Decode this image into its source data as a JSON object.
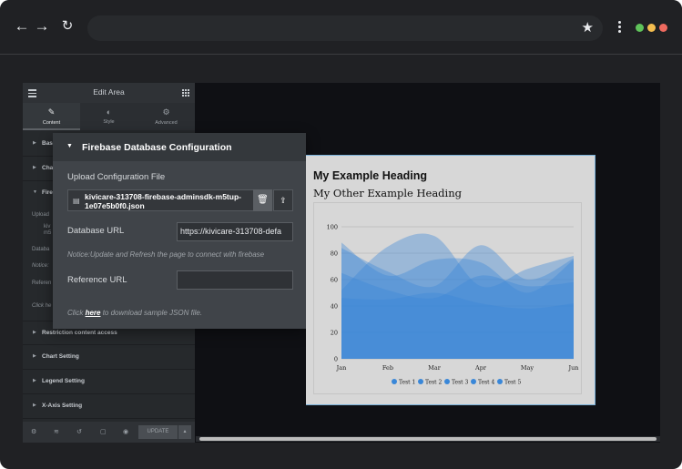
{
  "browser": {
    "back": "←",
    "forward": "→",
    "reload": "↻",
    "star": "★",
    "address": "",
    "traffic_colors": [
      "#5fc35a",
      "#f4bd4f",
      "#ee6a5f"
    ]
  },
  "panel": {
    "title": "Edit Area",
    "tabs": [
      {
        "label": "Content",
        "icon": "pencil-icon"
      },
      {
        "label": "Style",
        "icon": "contrast-icon"
      },
      {
        "label": "Advanced",
        "icon": "gear-icon"
      }
    ],
    "sections_top": [
      "Bas",
      "Cha",
      "Fire"
    ],
    "ghost_lines": [
      "Upload",
      "kiv",
      "m5",
      "Databa",
      "Notice:",
      "Referen",
      "Click he"
    ],
    "sections_bottom": [
      "Restriction content access",
      "Chart Setting",
      "Legend Setting",
      "X-Axis Setting"
    ],
    "footer": {
      "update": "UPDATE",
      "more": "▴"
    }
  },
  "popover": {
    "title": "Firebase Database Configuration",
    "upload_label": "Upload Configuration File",
    "file_name": "kivicare-313708-firebase-adminsdk-m5tup-1e07e5b0f0.json",
    "db_url_label": "Database URL",
    "db_url_value": "https://kivicare-313708-defa",
    "notice": "Notice:Update and Refresh the page to connect with firebase",
    "ref_url_label": "Reference URL",
    "ref_url_value": "",
    "hint_prefix": "Click ",
    "hint_link": "here",
    "hint_suffix": " to download sample JSON file."
  },
  "preview": {
    "heading": "My Example Heading",
    "subheading": "My Other Example Heading"
  },
  "chart_data": {
    "type": "area",
    "categories": [
      "Jan",
      "Feb",
      "Mar",
      "Apr",
      "May",
      "Jun"
    ],
    "y_ticks": [
      0,
      20,
      40,
      60,
      80,
      100
    ],
    "ylim": [
      0,
      100
    ],
    "grid": true,
    "legend_placement": "bottom",
    "fill_color": "#3a86d6",
    "series": [
      {
        "name": "Test 1",
        "values": [
          88,
          63,
          75,
          73,
          50,
          75
        ]
      },
      {
        "name": "Test 2",
        "values": [
          52,
          85,
          93,
          55,
          68,
          78
        ]
      },
      {
        "name": "Test 3",
        "values": [
          84,
          66,
          55,
          86,
          60,
          76
        ]
      },
      {
        "name": "Test 4",
        "values": [
          65,
          52,
          46,
          63,
          55,
          58
        ]
      },
      {
        "name": "Test 5",
        "values": [
          46,
          45,
          50,
          42,
          38,
          42
        ]
      }
    ],
    "series_colors": [
      "#3987d8",
      "#3987d8",
      "#3987d8",
      "#3987d8",
      "#3987d8"
    ]
  }
}
